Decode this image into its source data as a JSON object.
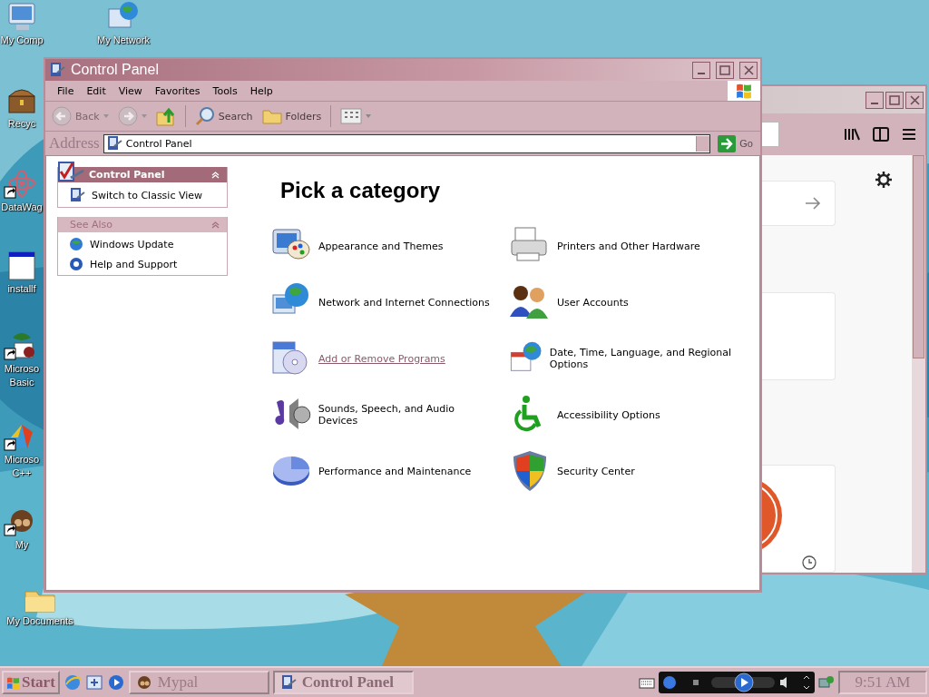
{
  "desktop_icons": [
    {
      "label": [
        "My Comp"
      ],
      "shortcut": false
    },
    {
      "label": [
        "My Network"
      ],
      "shortcut": false
    },
    {
      "label": [
        "Recyc"
      ],
      "shortcut": false
    },
    {
      "label": [
        "DataWag"
      ],
      "shortcut": true
    },
    {
      "label": [
        "installf"
      ],
      "shortcut": false
    },
    {
      "label": [
        "Microso",
        "Basic"
      ],
      "shortcut": true
    },
    {
      "label": [
        "Microso",
        "C++"
      ],
      "shortcut": true
    },
    {
      "label": [
        "My"
      ],
      "shortcut": true
    },
    {
      "label": [
        "My Documents"
      ],
      "shortcut": false
    }
  ],
  "control_panel": {
    "title": "Control Panel",
    "menu": [
      "File",
      "Edit",
      "View",
      "Favorites",
      "Tools",
      "Help"
    ],
    "toolbar": {
      "back": {
        "label": "Back",
        "disabled": true
      },
      "forward": {
        "disabled": true
      },
      "search": {
        "label": "Search"
      },
      "folders": {
        "label": "Folders"
      }
    },
    "address": {
      "label": "Address",
      "value": "Control Panel",
      "go": "Go"
    },
    "task_panes": [
      {
        "title": "Control Panel",
        "kind": "primary",
        "items": [
          "Switch to Classic View"
        ]
      },
      {
        "title": "See Also",
        "kind": "secondary",
        "items": [
          "Windows Update",
          "Help and Support"
        ]
      }
    ],
    "heading": "Pick a category",
    "categories": [
      {
        "label": "Appearance and Themes",
        "hovered": false
      },
      {
        "label": "Printers and Other Hardware",
        "hovered": false
      },
      {
        "label": "Network and Internet Connections",
        "hovered": false
      },
      {
        "label": "User Accounts",
        "hovered": false
      },
      {
        "label": "Add or Remove Programs",
        "hovered": true
      },
      {
        "label": "Date, Time, Language, and Regional Options",
        "hovered": false
      },
      {
        "label": "Sounds, Speech, and Audio Devices",
        "hovered": false
      },
      {
        "label": "Accessibility Options",
        "hovered": false
      },
      {
        "label": "Performance and Maintenance",
        "hovered": false
      },
      {
        "label": "Security Center",
        "hovered": false
      }
    ]
  },
  "taskbar": {
    "start": "Start",
    "tasks": [
      {
        "label": "Mypal",
        "selected": false
      },
      {
        "label": "Control Panel",
        "selected": true
      }
    ],
    "clock": "9:51 AM"
  }
}
